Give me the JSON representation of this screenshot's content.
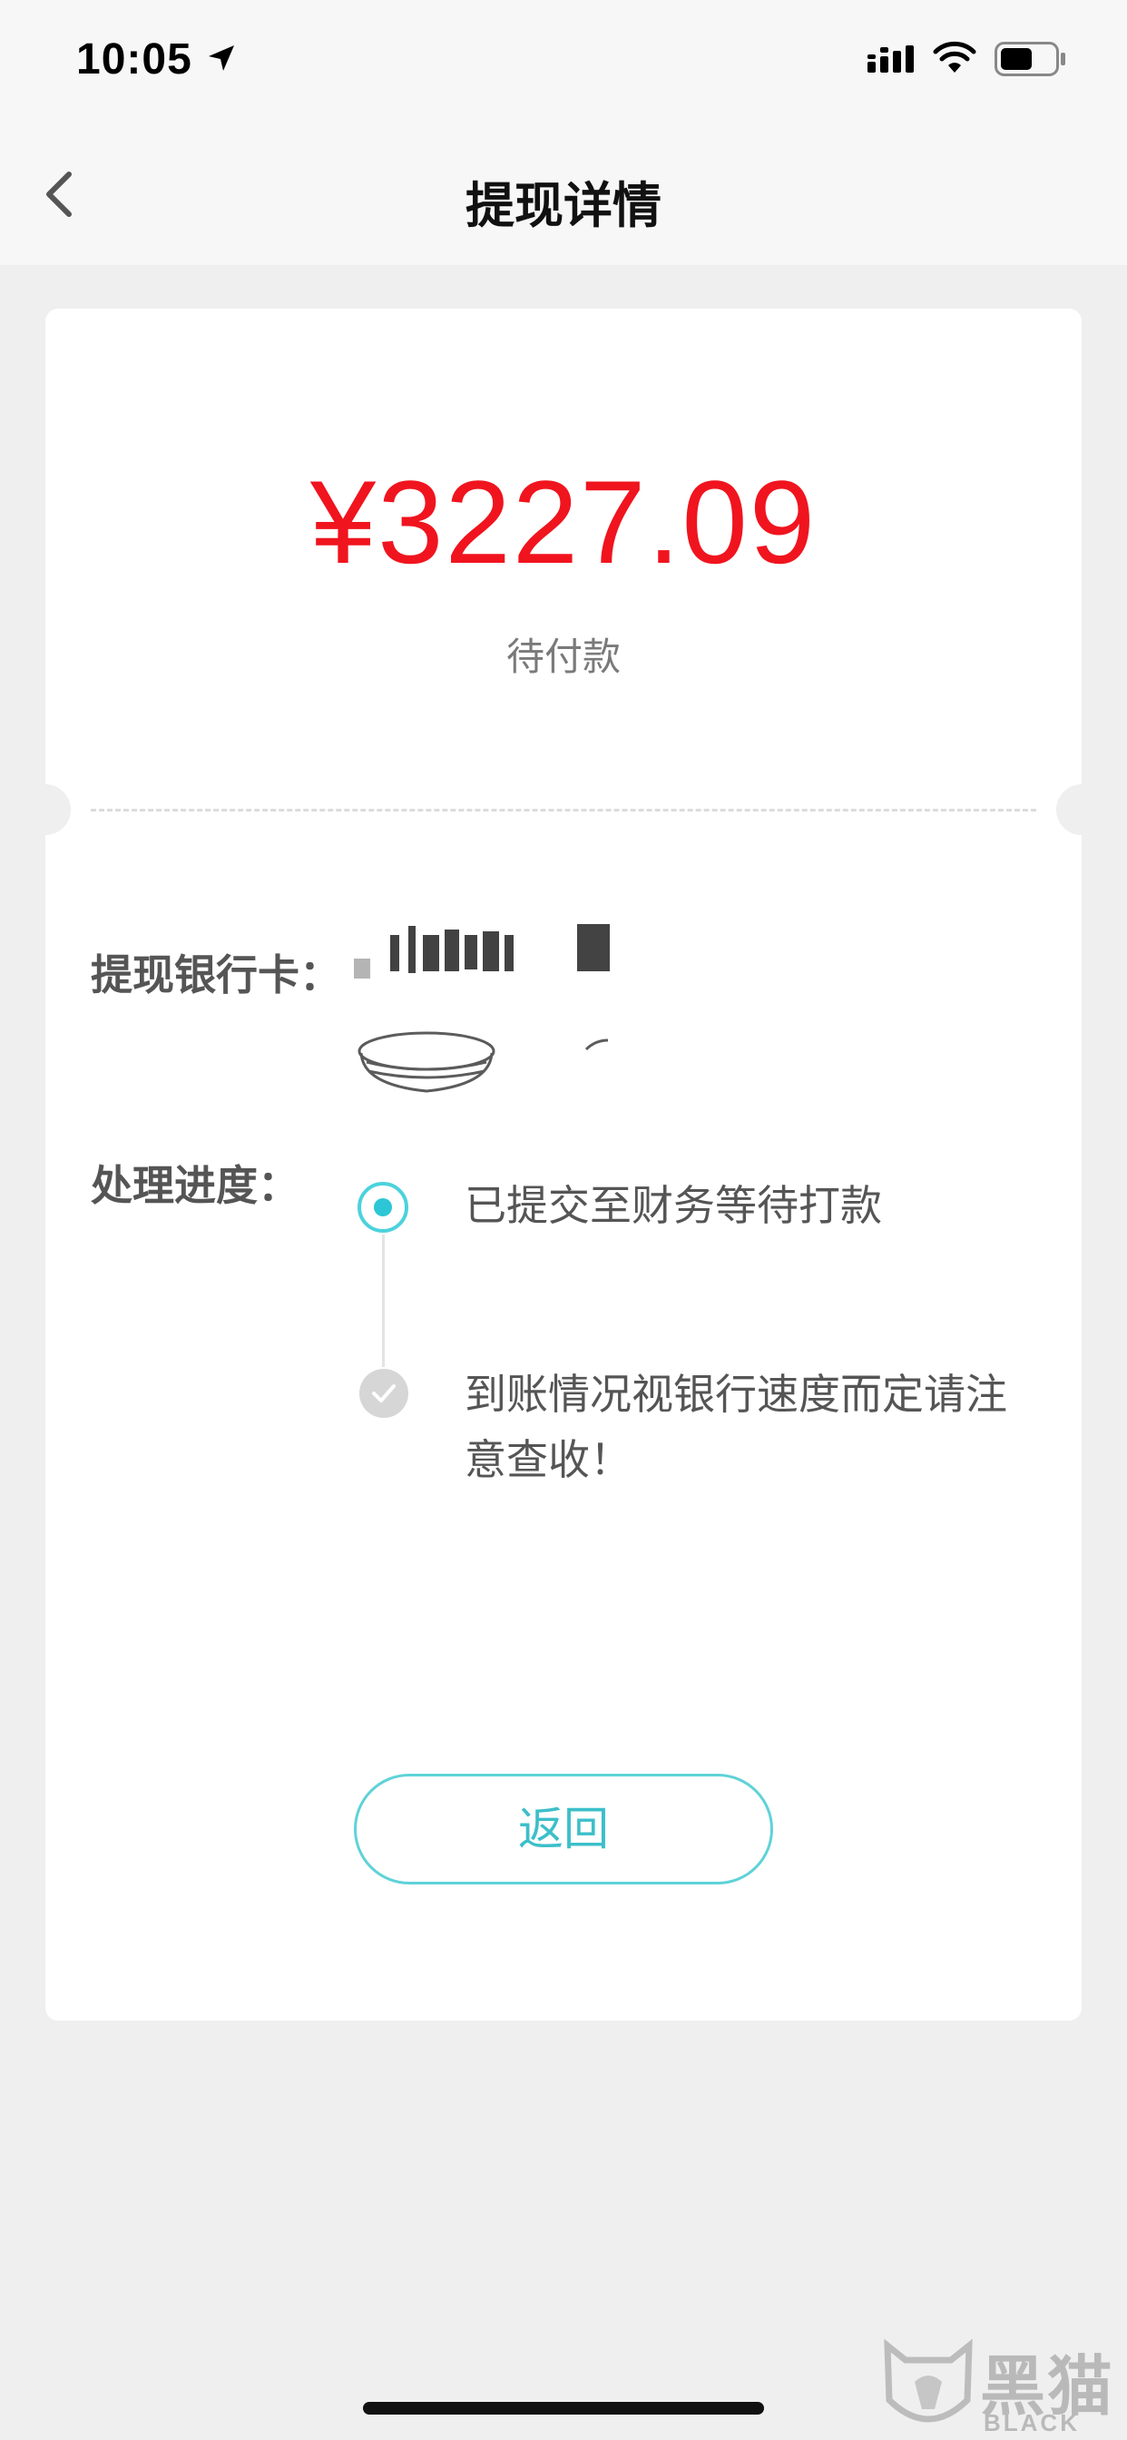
{
  "status_bar": {
    "time": "10:05",
    "icons": [
      "location-arrow-icon",
      "signal-icon",
      "wifi-icon",
      "battery-icon"
    ]
  },
  "nav": {
    "title": "提现详情",
    "back_icon": "chevron-left-icon"
  },
  "withdrawal": {
    "amount": "¥3227.09",
    "status": "待付款"
  },
  "bank_card": {
    "label": "提现银行卡："
  },
  "progress": {
    "label": "处理进度：",
    "steps": [
      {
        "text": "已提交至财务等待打款",
        "state": "active"
      },
      {
        "text": "到账情况视银行速度而定请注意查收！",
        "state": "done"
      }
    ]
  },
  "actions": {
    "return_label": "返回"
  },
  "watermark": {
    "cn": "黑猫",
    "en": "BLACK CAT"
  },
  "colors": {
    "amount": "#f0141e",
    "accent": "#3cbfc9",
    "background": "#efefef"
  }
}
